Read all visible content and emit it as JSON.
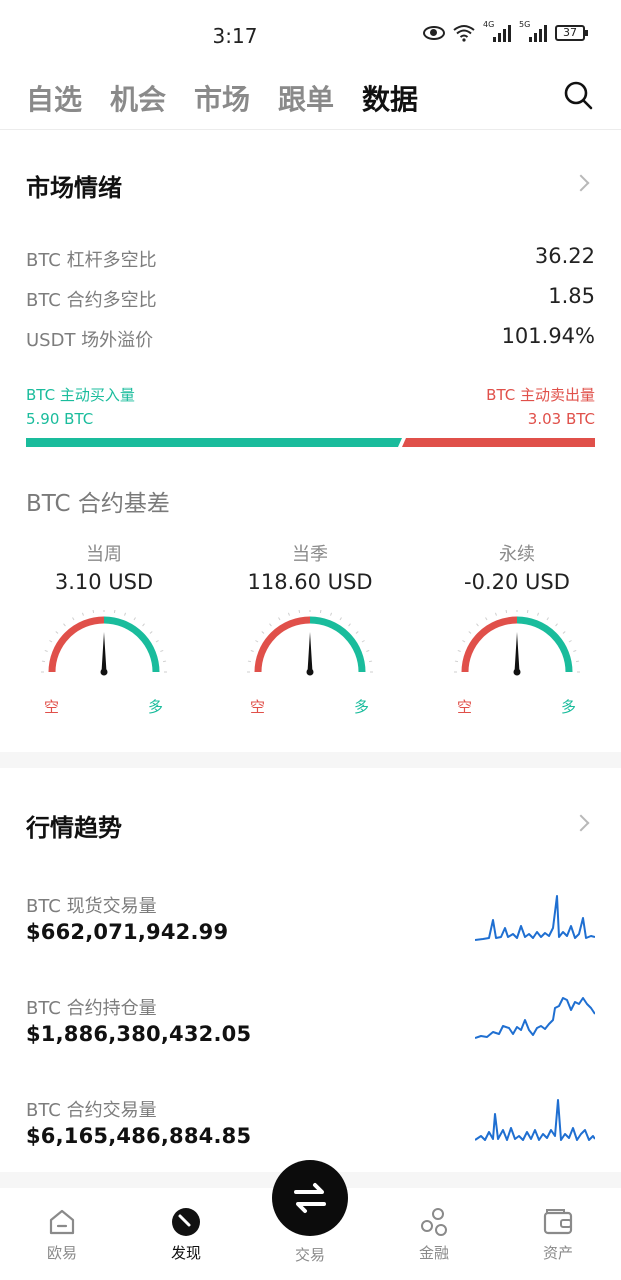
{
  "status": {
    "time": "3:17",
    "battery": "37",
    "net1": "4G",
    "net2": "5G"
  },
  "tabs": [
    "自选",
    "机会",
    "市场",
    "跟单",
    "数据"
  ],
  "sentiment": {
    "title": "市场情绪",
    "rows": [
      {
        "label": "BTC 杠杆多空比",
        "value": "36.22"
      },
      {
        "label": "BTC 合约多空比",
        "value": "1.85"
      },
      {
        "label": "USDT 场外溢价",
        "value": "101.94%"
      }
    ],
    "buy_label": "BTC 主动买入量",
    "buy_value": "5.90 BTC",
    "sell_label": "BTC 主动卖出量",
    "sell_value": "3.03 BTC",
    "buy_share": 0.66,
    "buy_color": "#1abc9c",
    "sell_color": "#e0504a"
  },
  "basis": {
    "title": "BTC 合约基差",
    "short_label": "空",
    "long_label": "多",
    "items": [
      {
        "name": "当周",
        "value": "3.10 USD",
        "needle": 0.0
      },
      {
        "name": "当季",
        "value": "118.60 USD",
        "needle": 0.0
      },
      {
        "name": "永续",
        "value": "-0.20 USD",
        "needle": 0.0
      }
    ]
  },
  "trend": {
    "title": "行情趋势",
    "rows": [
      {
        "label": "BTC 现货交易量",
        "value": "$662,071,942.99"
      },
      {
        "label": "BTC 合约持仓量",
        "value": "$1,886,380,432.05"
      },
      {
        "label": "BTC 合约交易量",
        "value": "$6,165,486,884.85"
      }
    ],
    "line_color": "#1f6fd1"
  },
  "bottom_nav": [
    "欧易",
    "发现",
    "交易",
    "金融",
    "资产"
  ]
}
